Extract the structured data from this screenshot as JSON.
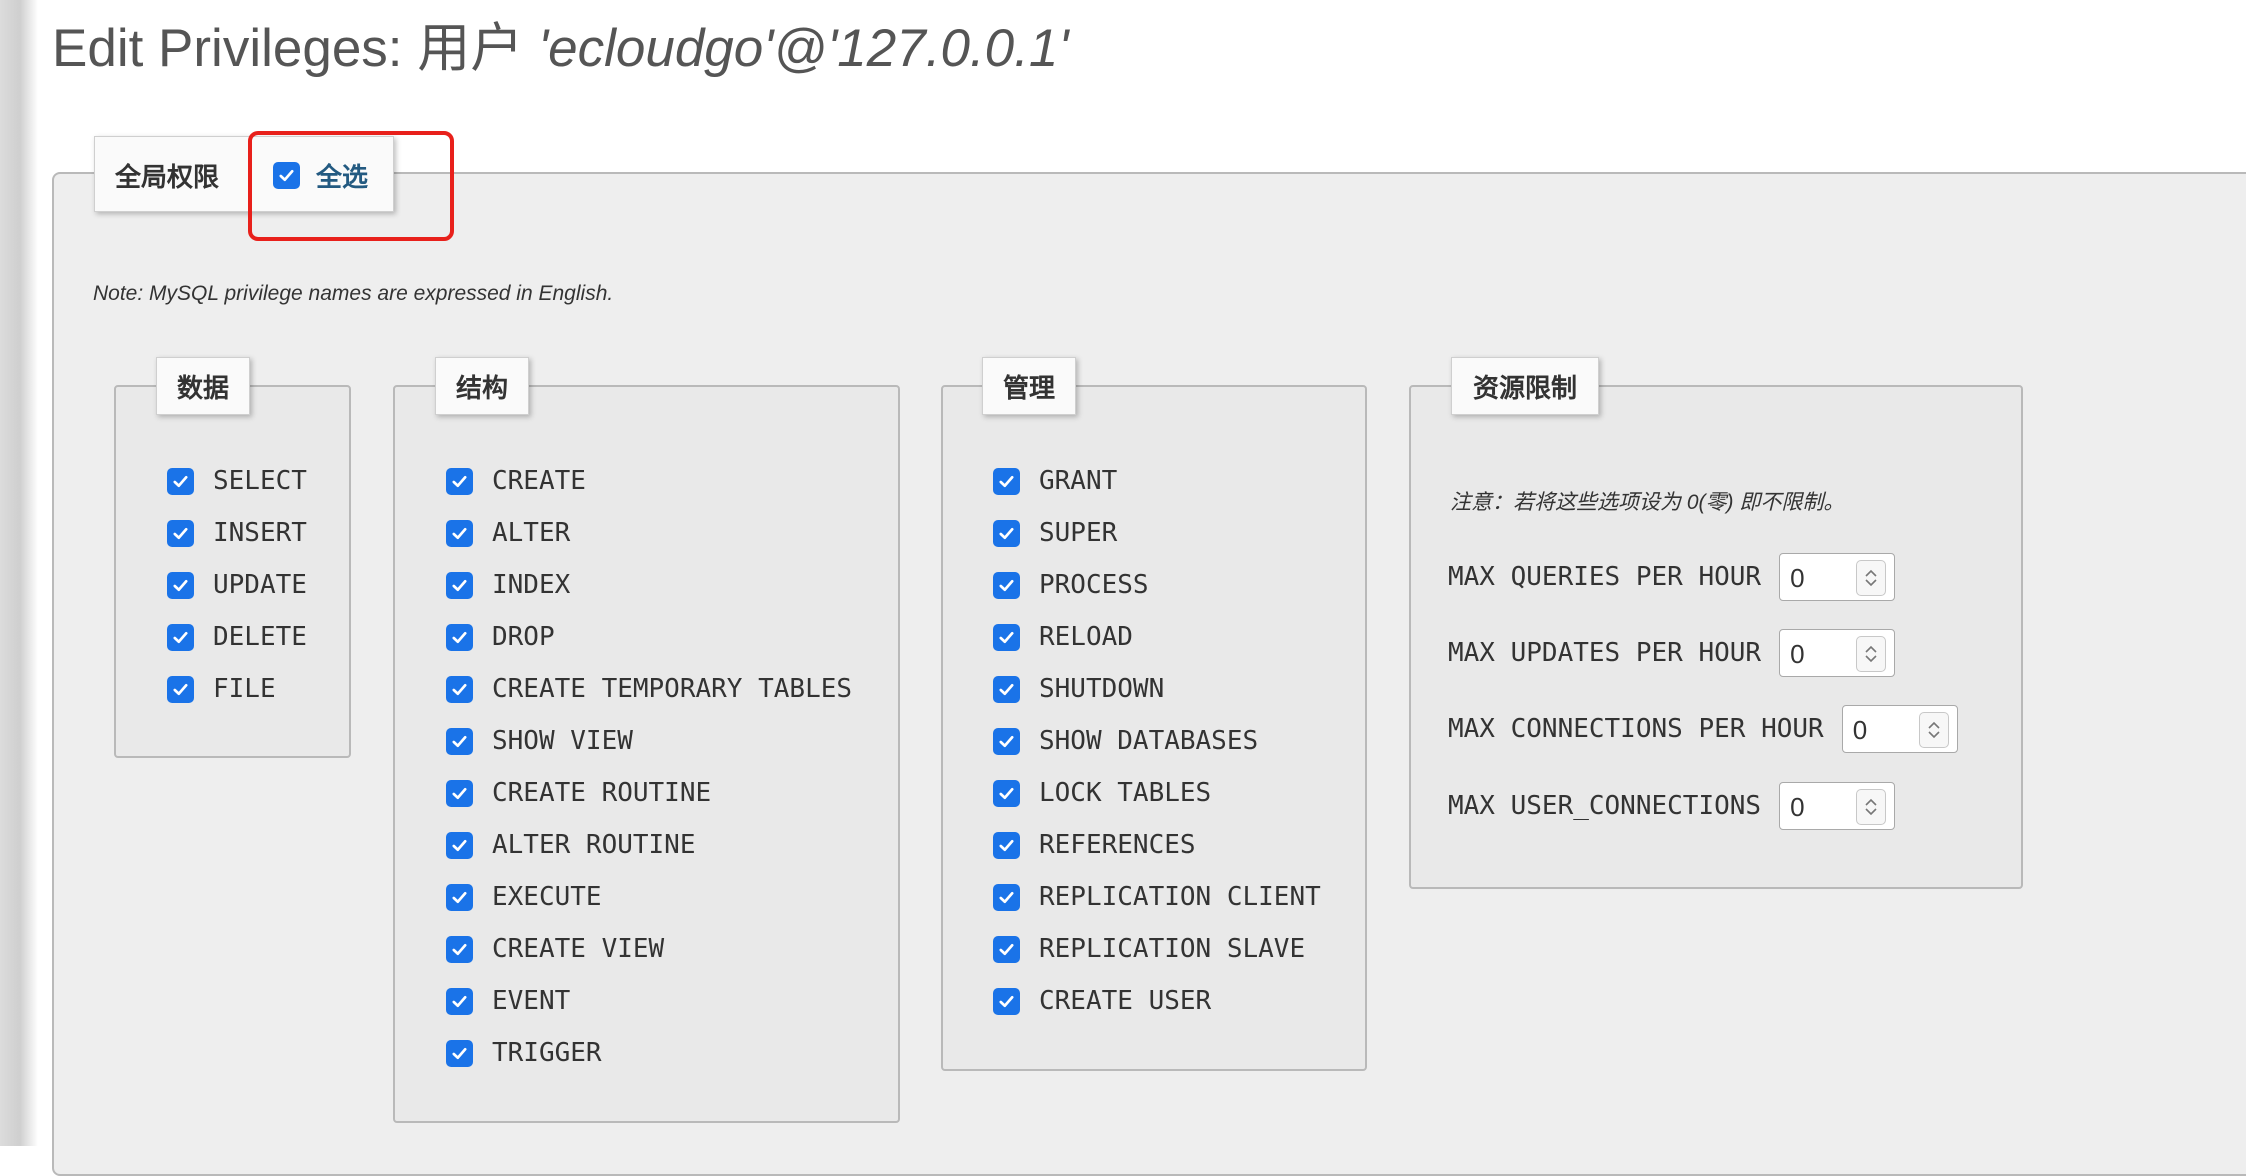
{
  "page": {
    "title_prefix": "Edit Privileges: ",
    "title_user_word": "用户",
    "title_user": "'ecloudgo'@'127.0.0.1'"
  },
  "global": {
    "legend_label": "全局权限",
    "select_all_label": "全选",
    "select_all_checked": true,
    "note": "Note: MySQL privilege names are expressed in English."
  },
  "groups": {
    "data": {
      "label": "数据",
      "items": [
        "SELECT",
        "INSERT",
        "UPDATE",
        "DELETE",
        "FILE"
      ]
    },
    "structure": {
      "label": "结构",
      "items": [
        "CREATE",
        "ALTER",
        "INDEX",
        "DROP",
        "CREATE TEMPORARY TABLES",
        "SHOW VIEW",
        "CREATE ROUTINE",
        "ALTER ROUTINE",
        "EXECUTE",
        "CREATE VIEW",
        "EVENT",
        "TRIGGER"
      ]
    },
    "admin": {
      "label": "管理",
      "items": [
        "GRANT",
        "SUPER",
        "PROCESS",
        "RELOAD",
        "SHUTDOWN",
        "SHOW DATABASES",
        "LOCK TABLES",
        "REFERENCES",
        "REPLICATION CLIENT",
        "REPLICATION SLAVE",
        "CREATE USER"
      ]
    }
  },
  "resource_limits": {
    "label": "资源限制",
    "note": "注意：若将这些选项设为 0(零) 即不限制。",
    "fields": [
      {
        "label": "MAX QUERIES PER HOUR",
        "value": "0"
      },
      {
        "label": "MAX UPDATES PER HOUR",
        "value": "0"
      },
      {
        "label": "MAX CONNECTIONS PER HOUR",
        "value": "0"
      },
      {
        "label": "MAX USER_CONNECTIONS",
        "value": "0"
      }
    ]
  },
  "colors": {
    "checkbox": "#1a73e8",
    "highlight": "#e8201b",
    "link": "#235a81",
    "panel_bg": "#eeeeee"
  }
}
